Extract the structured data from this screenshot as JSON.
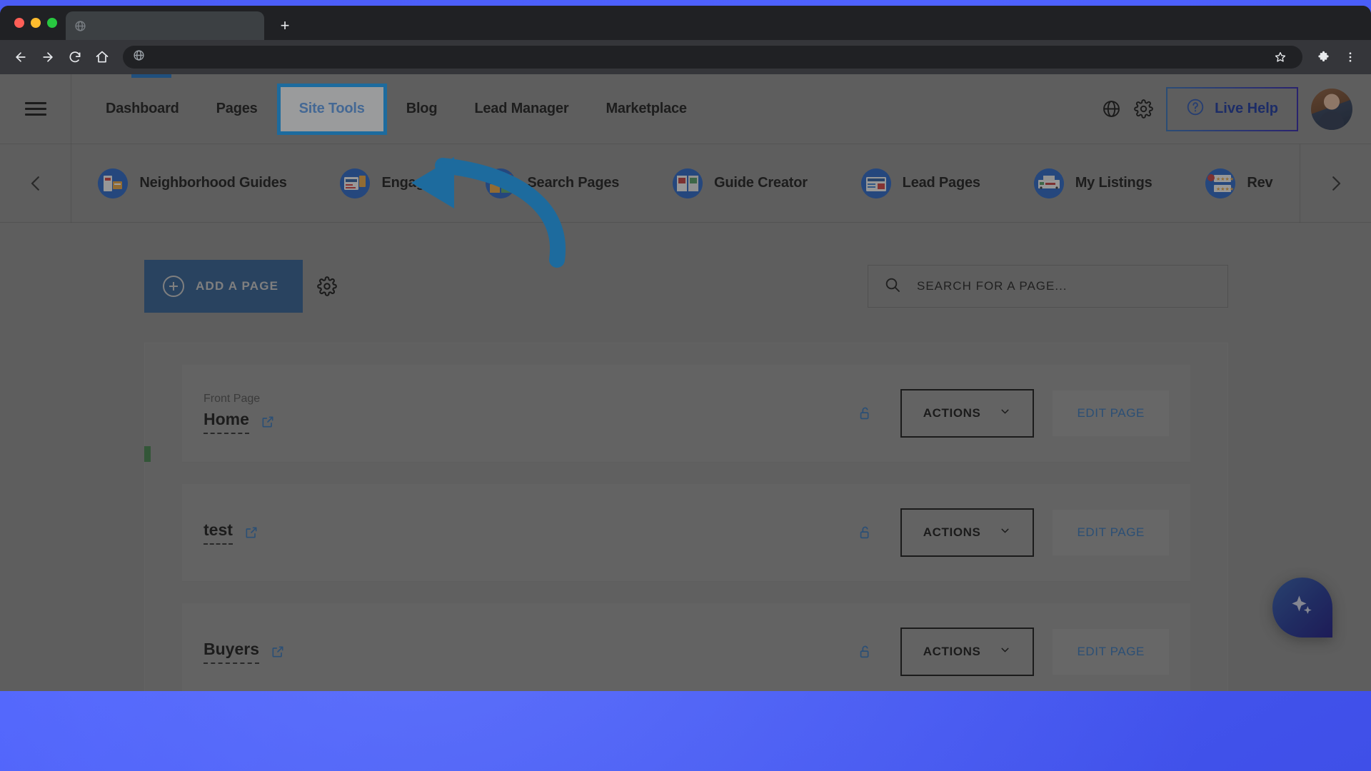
{
  "browser": {
    "tab": {
      "title": "",
      "favicon": "globe-icon"
    },
    "new_tab_label": "+",
    "omnibox": {
      "value": "",
      "placeholder": ""
    },
    "buttons": {
      "back": "back-arrow-icon",
      "forward": "forward-arrow-icon",
      "reload": "reload-icon",
      "home": "home-icon",
      "bookmark": "star-icon",
      "extensions": "puzzle-icon",
      "menu": "three-dot-menu-icon"
    }
  },
  "app_header": {
    "menu_icon": "hamburger-icon",
    "nav": [
      {
        "label": "Dashboard",
        "active": false,
        "highlighted": false
      },
      {
        "label": "Pages",
        "active": true,
        "highlighted": false
      },
      {
        "label": "Site Tools",
        "active": false,
        "highlighted": true
      },
      {
        "label": "Blog",
        "active": false,
        "highlighted": false
      },
      {
        "label": "Lead Manager",
        "active": false,
        "highlighted": false
      },
      {
        "label": "Marketplace",
        "active": false,
        "highlighted": false
      }
    ],
    "right": {
      "globe_icon": "globe-icon",
      "settings_icon": "gear-icon",
      "live_help_label": "Live Help",
      "help_icon": "question-circle-icon",
      "avatar": "user-avatar"
    }
  },
  "app_bar": {
    "prev_label": "‹",
    "next_label": "›",
    "apps": [
      {
        "label": "Neighborhood Guides"
      },
      {
        "label": "Engage"
      },
      {
        "label": "Search Pages"
      },
      {
        "label": "Guide Creator"
      },
      {
        "label": "Lead Pages"
      },
      {
        "label": "My Listings"
      },
      {
        "label": "Rev"
      }
    ]
  },
  "content": {
    "add_page_label": "ADD A PAGE",
    "settings_icon": "gear-icon",
    "search": {
      "value": "",
      "placeholder": "SEARCH FOR A PAGE..."
    },
    "rows": [
      {
        "tag": "Front Page",
        "title": "Home",
        "lock": "unlock-icon",
        "actions_label": "ACTIONS",
        "edit_label": "EDIT PAGE"
      },
      {
        "tag": "",
        "title": "test",
        "lock": "unlock-icon",
        "actions_label": "ACTIONS",
        "edit_label": "EDIT PAGE"
      },
      {
        "tag": "",
        "title": "Buyers",
        "lock": "unlock-icon",
        "actions_label": "ACTIONS",
        "edit_label": "EDIT PAGE"
      }
    ],
    "fab": "ai-sparkle-icon"
  },
  "annotation": {
    "arrow_color": "#14a3ff",
    "highlight_border_color": "#14a3ff",
    "target": "Site Tools"
  },
  "colors": {
    "accent_blue": "#2f6fb5",
    "button_blue": "#2b5a8e",
    "highlight": "#14a3ff",
    "desktop": "#4a5cf5"
  }
}
